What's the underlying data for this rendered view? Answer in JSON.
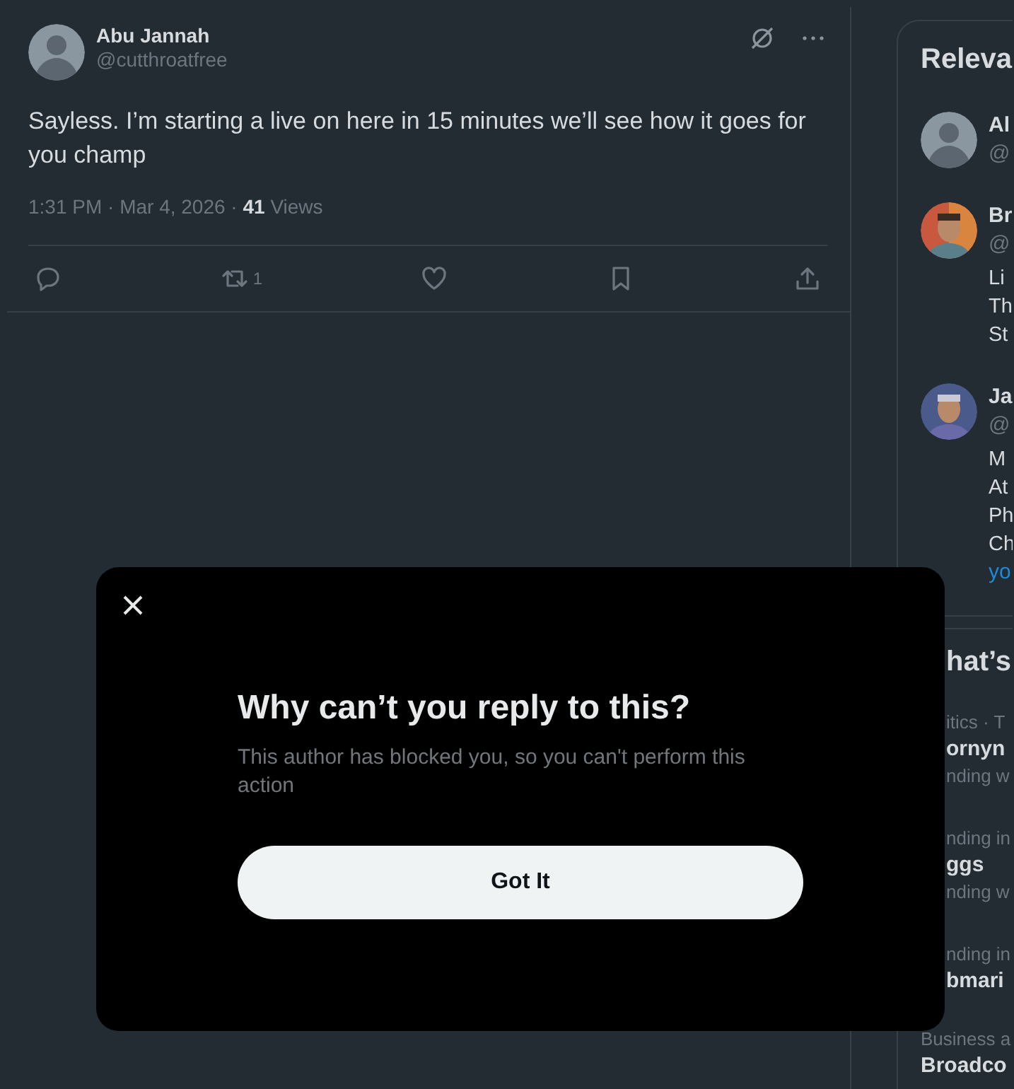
{
  "tweet": {
    "author": {
      "name": "Abu Jannah",
      "handle": "@cutthroatfree",
      "avatar": {
        "kind": "placeholder"
      }
    },
    "text": "Sayless. I’m starting a live on here in 15 minutes we’ll see how it goes for you champ",
    "meta": "1:31 PM · Mar 4, 2026 · **41** Views",
    "actions": [
      {
        "kind": "reply"
      },
      {
        "kind": "repost",
        "count": "1"
      },
      {
        "kind": "like"
      },
      {
        "kind": "bookmark"
      },
      {
        "kind": "share"
      }
    ]
  },
  "relevant_people": {
    "title": "Releva",
    "people": [
      {
        "avatar": {
          "kind": "placeholder"
        },
        "name": "Al",
        "handle": "@"
      },
      {
        "avatar": {
          "kind": "picture"
        },
        "name": "Br",
        "handle": "@",
        "bio": [
          "Li",
          "Th",
          "St"
        ]
      },
      {
        "avatar": {
          "kind": "picture"
        },
        "name": "Ja",
        "handle": "@",
        "bio": [
          "M",
          "At",
          "Ph",
          "Ch"
        ],
        "link": "yo"
      }
    ]
  },
  "trends": {
    "title": "hat’s",
    "items": [
      {
        "kind": "clipped",
        "context": "itics · T",
        "name": "ornyn",
        "meta": "nding w"
      },
      {
        "kind": "clipped",
        "context": "nding in",
        "name": "ggs",
        "meta": "nding w"
      },
      {
        "kind": "clipped",
        "context": "nding in",
        "name": "bmari"
      },
      {
        "kind": "full",
        "context": "Business a",
        "name": "Broadco"
      }
    ]
  },
  "dialog": {
    "title": "Why can’t you reply to this?",
    "message": "This author has blocked you, so you can't perform this action",
    "button": "Got It"
  }
}
